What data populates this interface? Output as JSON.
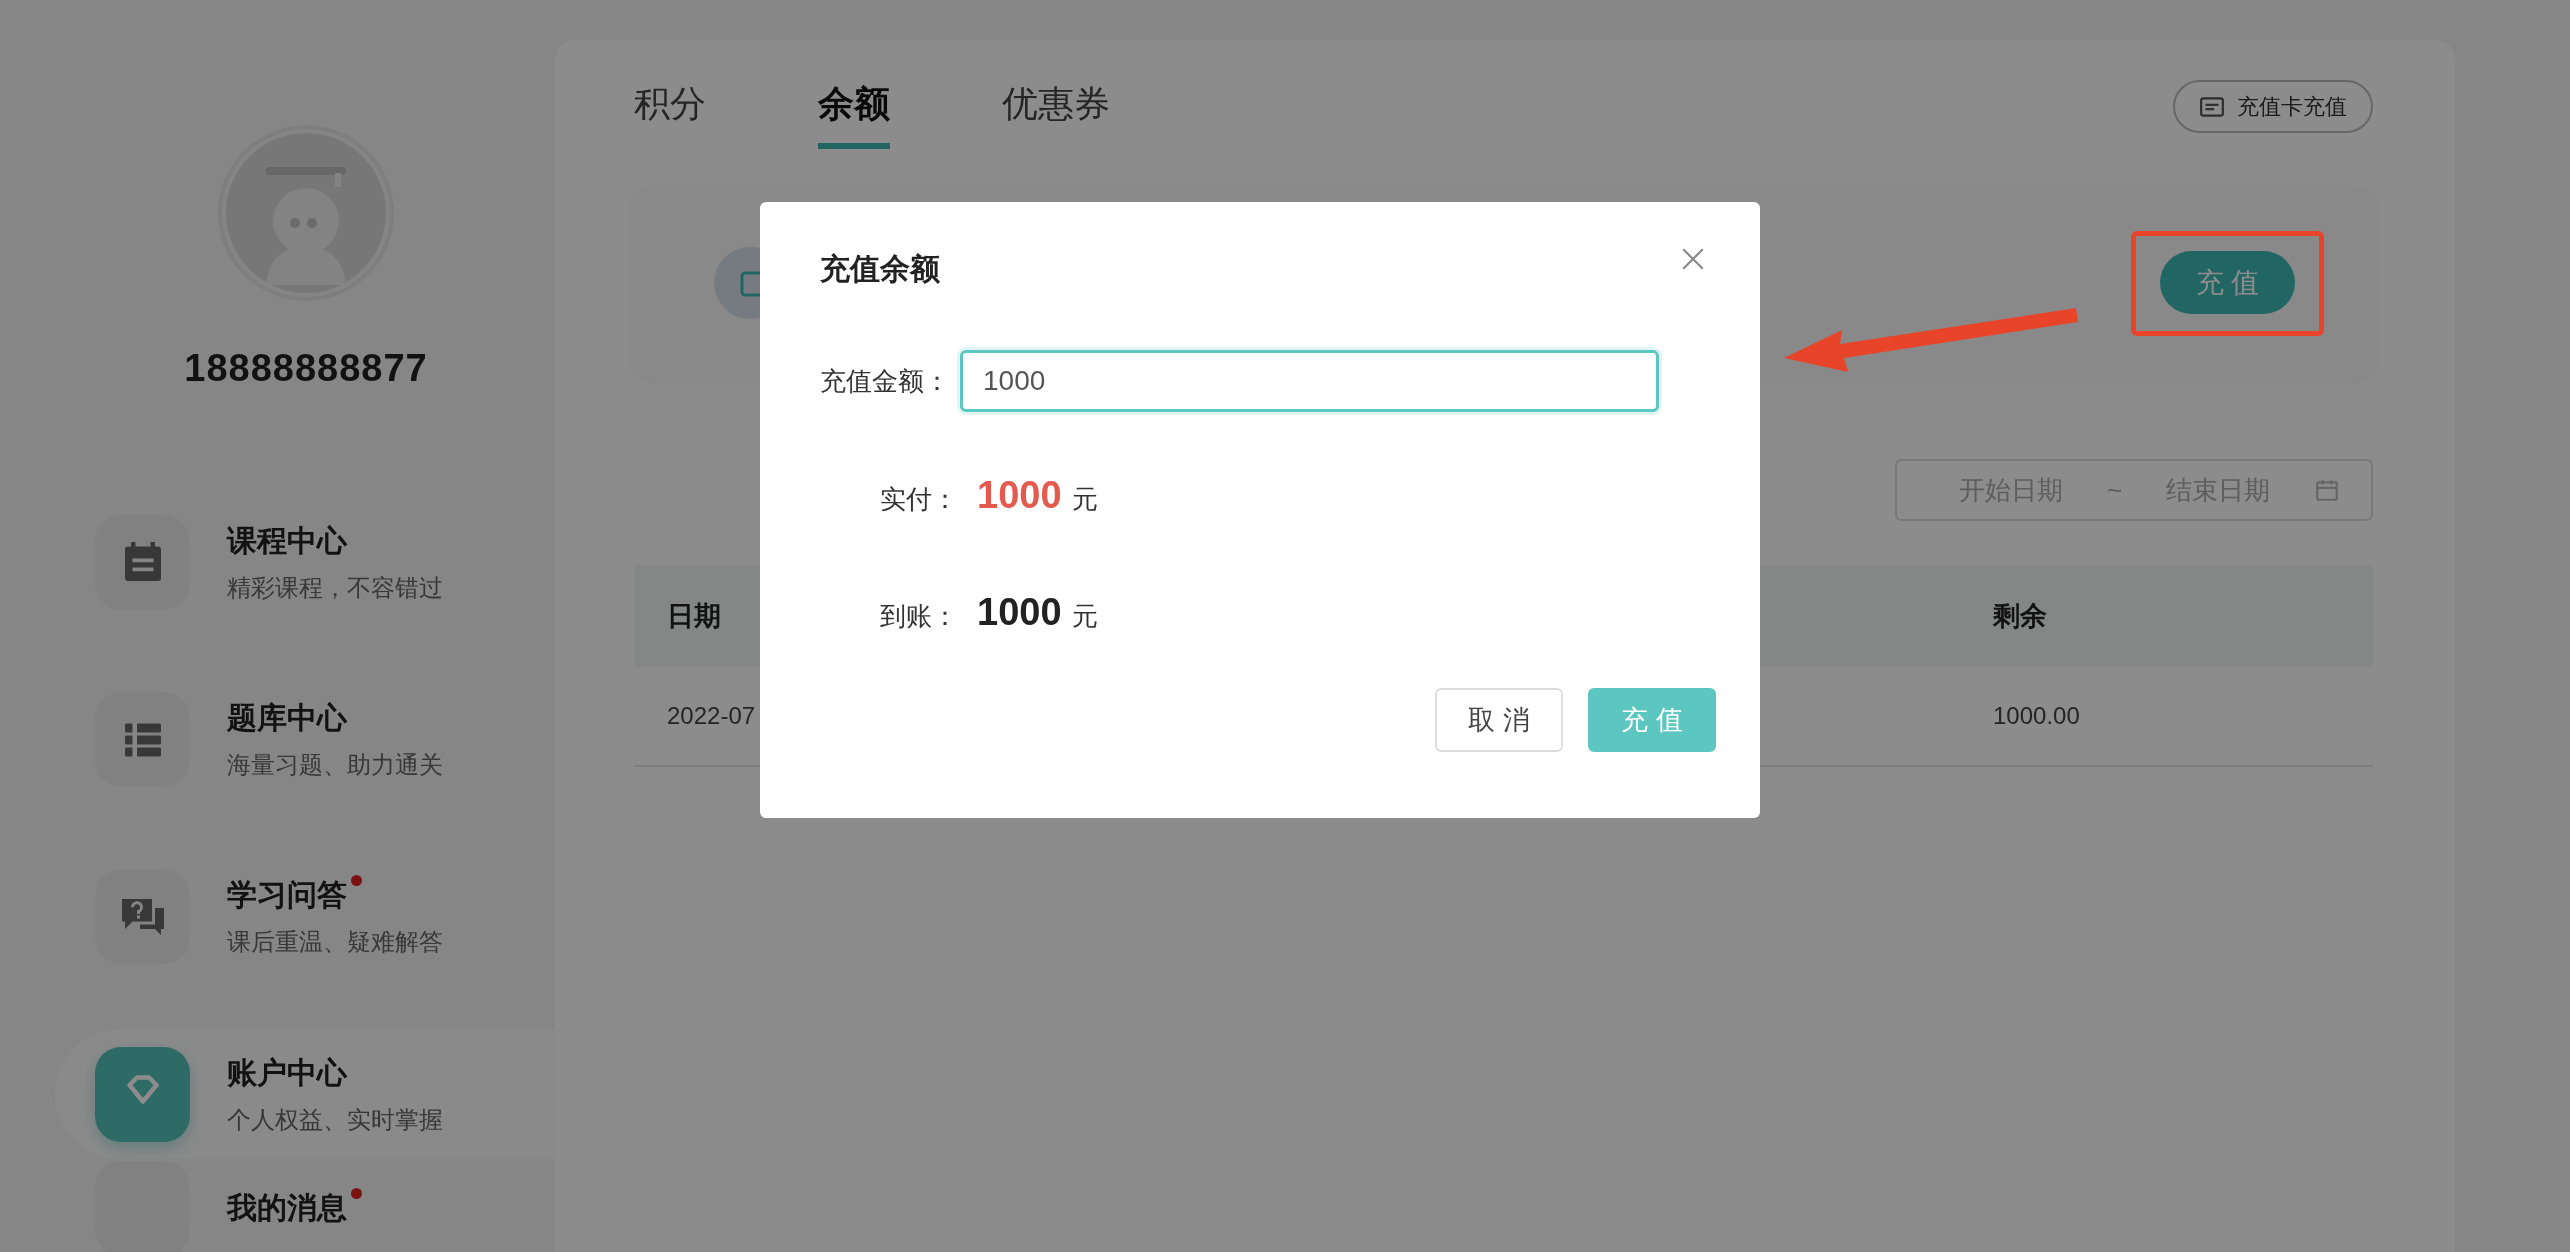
{
  "user": {
    "phone": "18888888877"
  },
  "menu": [
    {
      "title": "课程中心",
      "subtitle": "精彩课程，不容错过",
      "selected": false,
      "dot": false
    },
    {
      "title": "题库中心",
      "subtitle": "海量习题、助力通关",
      "selected": false,
      "dot": false
    },
    {
      "title": "学习问答",
      "subtitle": "课后重温、疑难解答",
      "selected": false,
      "dot": true
    },
    {
      "title": "账户中心",
      "subtitle": "个人权益、实时掌握",
      "selected": true,
      "dot": false
    },
    {
      "title": "我的消息",
      "selected": false,
      "dot": true
    }
  ],
  "tabs": [
    {
      "label": "积分",
      "selected": false
    },
    {
      "label": "余额",
      "selected": true
    },
    {
      "label": "优惠券",
      "selected": false
    }
  ],
  "card_recharge_button": "充值卡充值",
  "recharge_button": "充 值",
  "date_range": {
    "start_placeholder": "开始日期",
    "separator": "~",
    "end_placeholder": "结束日期"
  },
  "table": {
    "columns": [
      "日期",
      "剩余"
    ],
    "rows": [
      [
        "2022-07",
        "1000.00"
      ]
    ]
  },
  "dialog": {
    "title": "充值余额",
    "amount_label": "充值金额：",
    "amount_value": "1000",
    "paid_label": "实付：",
    "paid_value": "1000",
    "paid_unit": "元",
    "received_label": "到账：",
    "received_value": "1000",
    "received_unit": "元",
    "buttons": [
      {
        "label": "取 消",
        "kind": "secondary"
      },
      {
        "label": "充 值",
        "kind": "primary"
      }
    ]
  }
}
